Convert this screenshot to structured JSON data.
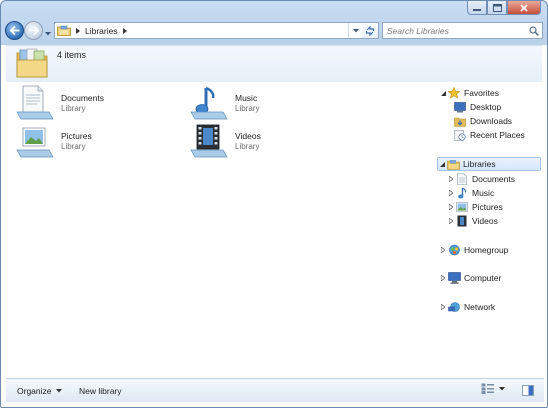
{
  "window": {
    "caption_buttons": [
      "minimize",
      "maximize",
      "close"
    ]
  },
  "address_bar": {
    "breadcrumbs": [
      "Libraries"
    ],
    "icon": "libraries-folder-icon"
  },
  "search": {
    "placeholder": "Search Libraries"
  },
  "details": {
    "count_text": "4 items",
    "icon": "libraries-folder-icon"
  },
  "items": [
    {
      "name": "Documents",
      "type": "Library",
      "icon": "documents-library-icon"
    },
    {
      "name": "Music",
      "type": "Library",
      "icon": "music-library-icon"
    },
    {
      "name": "Pictures",
      "type": "Library",
      "icon": "pictures-library-icon"
    },
    {
      "name": "Videos",
      "type": "Library",
      "icon": "videos-library-icon"
    }
  ],
  "navpane": {
    "favorites": {
      "label": "Favorites",
      "children": [
        {
          "label": "Desktop",
          "icon": "desktop-icon"
        },
        {
          "label": "Downloads",
          "icon": "downloads-icon"
        },
        {
          "label": "Recent Places",
          "icon": "recent-places-icon"
        }
      ]
    },
    "libraries": {
      "label": "Libraries",
      "selected": true,
      "children": [
        {
          "label": "Documents",
          "icon": "documents-icon"
        },
        {
          "label": "Music",
          "icon": "music-icon"
        },
        {
          "label": "Pictures",
          "icon": "pictures-icon"
        },
        {
          "label": "Videos",
          "icon": "videos-icon"
        }
      ]
    },
    "homegroup": {
      "label": "Homegroup"
    },
    "computer": {
      "label": "Computer"
    },
    "network": {
      "label": "Network"
    }
  },
  "toolbar": {
    "organize_label": "Organize",
    "new_library_label": "New library"
  },
  "colors": {
    "accent": "#3b7ac9",
    "frame": "#b9d1ea",
    "selection": "#d4e6fb"
  }
}
